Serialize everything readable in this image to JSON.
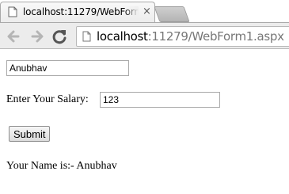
{
  "browser": {
    "tab_title": "localhost:11279/WebForm",
    "tab_close": "×",
    "url_host": "localhost",
    "url_rest": ":11279/WebForm1.aspx"
  },
  "form": {
    "name_value": "Anubhav",
    "salary_label": "Enter Your Salary:",
    "salary_value": "123",
    "submit_label": "Submit",
    "result_text": "Your Name is:- Anubhav"
  }
}
